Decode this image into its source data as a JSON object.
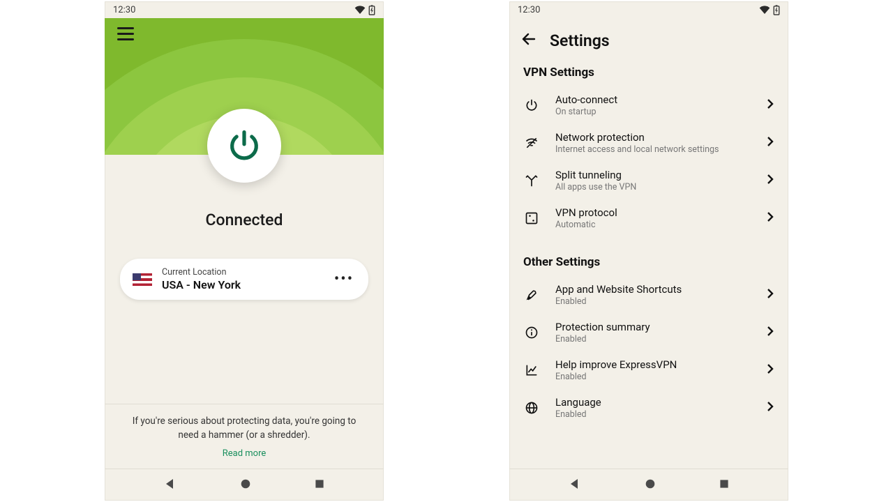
{
  "status": {
    "time": "12:30"
  },
  "left": {
    "status": "Connected",
    "location_label": "Current Location",
    "location_name": "USA - New York",
    "footer": "If you're serious about protecting data, you're going to need a hammer (or a shredder).",
    "read_more": "Read more"
  },
  "right": {
    "title": "Settings",
    "vpn_section": "VPN Settings",
    "other_section": "Other Settings",
    "vpn_items": [
      {
        "title": "Auto-connect",
        "sub": "On startup"
      },
      {
        "title": "Network protection",
        "sub": "Internet access and local network settings"
      },
      {
        "title": "Split tunneling",
        "sub": "All apps use the VPN"
      },
      {
        "title": "VPN protocol",
        "sub": "Automatic"
      }
    ],
    "other_items": [
      {
        "title": "App and Website Shortcuts",
        "sub": "Enabled"
      },
      {
        "title": "Protection summary",
        "sub": "Enabled"
      },
      {
        "title": "Help improve ExpressVPN",
        "sub": "Enabled"
      },
      {
        "title": "Language",
        "sub": "Enabled"
      }
    ]
  }
}
